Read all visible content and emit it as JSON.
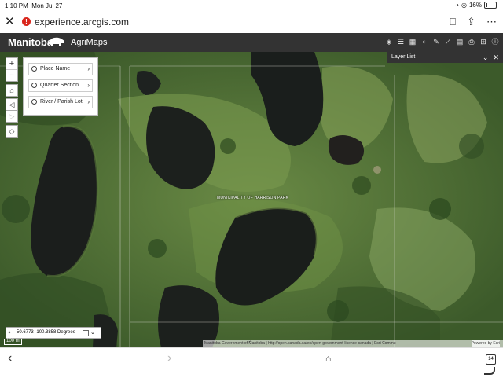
{
  "status": {
    "time": "1:10 PM",
    "date": "Mon Jul 27",
    "battery": "16%"
  },
  "browser": {
    "url": "experience.arcgis.com"
  },
  "header": {
    "brand": "Manitoba",
    "app_name": "AgriMaps"
  },
  "search": {
    "items": [
      "Place Name",
      "Quarter Section",
      "River / Parish Lot"
    ]
  },
  "zoom": {
    "plus": "+",
    "minus": "−"
  },
  "layer_list": {
    "title": "Layer List"
  },
  "map": {
    "label": "MUNICIPALITY OF HARRISON PARK"
  },
  "coords": {
    "text": "50.6773 -100.3858 Degrees"
  },
  "scale": {
    "text": "100 m"
  },
  "attribution": {
    "text": "Manitoba Government of Manitoba | http://open.canada.ca/en/open-government-licence-canada | Esri Commu",
    "powered": "Powered by Esri"
  },
  "tabs": {
    "count": "14"
  }
}
